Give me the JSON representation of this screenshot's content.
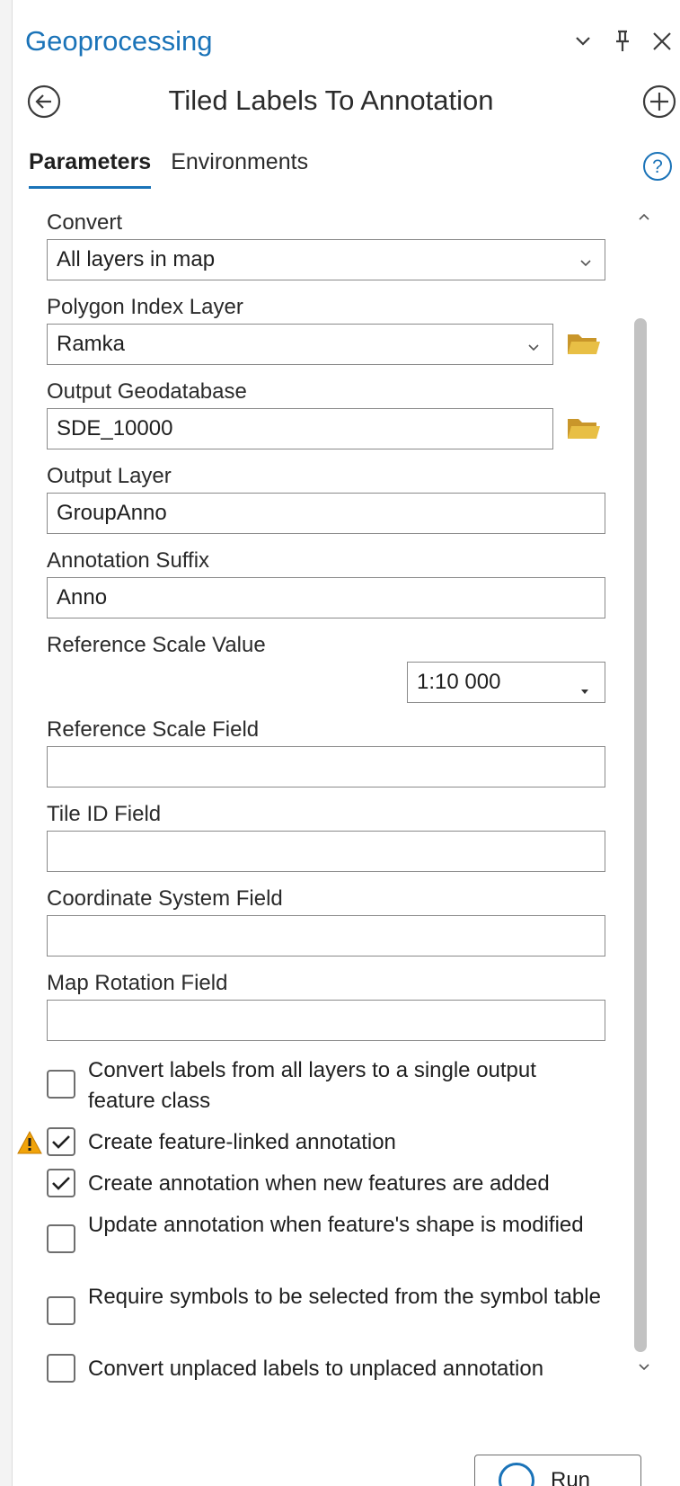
{
  "panel": {
    "title": "Geoprocessing",
    "tool_title": "Tiled Labels To Annotation",
    "colors": {
      "accent": "#1a73b8",
      "folder": "#e0b43c",
      "warning": "#f0a30a"
    }
  },
  "tabs": [
    {
      "label": "Parameters",
      "active": true
    },
    {
      "label": "Environments",
      "active": false
    }
  ],
  "params": {
    "convert": {
      "label": "Convert",
      "value": "All layers in map"
    },
    "polygon_index": {
      "label": "Polygon Index Layer",
      "value": "Ramka"
    },
    "output_gdb": {
      "label": "Output Geodatabase",
      "value": "SDE_10000"
    },
    "output_layer": {
      "label": "Output Layer",
      "value": "GroupAnno"
    },
    "anno_suffix": {
      "label": "Annotation Suffix",
      "value": "Anno"
    },
    "ref_scale_value": {
      "label": "Reference Scale Value",
      "value": "1:10 000"
    },
    "ref_scale_field": {
      "label": "Reference Scale Field",
      "value": ""
    },
    "tile_id_field": {
      "label": "Tile ID Field",
      "value": ""
    },
    "coord_sys_field": {
      "label": "Coordinate System Field",
      "value": ""
    },
    "map_rotation_field": {
      "label": "Map Rotation Field",
      "value": ""
    }
  },
  "checkboxes": [
    {
      "label": "Convert labels from all layers to a single output feature class",
      "checked": false,
      "warning": false
    },
    {
      "label": "Create feature-linked annotation",
      "checked": true,
      "warning": true
    },
    {
      "label": "Create annotation when new features are added",
      "checked": true,
      "warning": false
    },
    {
      "label": "Update annotation when feature's shape is modified",
      "checked": false,
      "warning": false
    },
    {
      "label": "Require symbols to be selected from the symbol table",
      "checked": false,
      "warning": false
    },
    {
      "label": "Convert unplaced labels to unplaced annotation",
      "checked": false,
      "warning": false
    }
  ],
  "run_button": {
    "label": "Run"
  },
  "icons": {
    "options": "chevron-down-icon",
    "pin": "pin-icon",
    "close": "close-icon",
    "back": "back-arrow-icon",
    "add": "add-icon",
    "help": "help-icon",
    "folder": "folder-icon",
    "warning": "warning-icon"
  }
}
